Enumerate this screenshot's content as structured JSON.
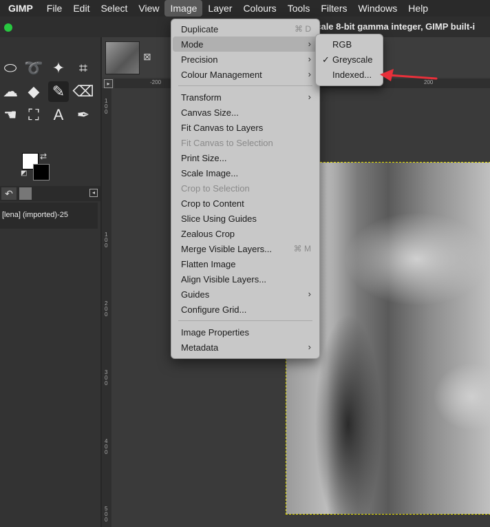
{
  "menubar": {
    "app": "GIMP",
    "items": [
      "File",
      "Edit",
      "Select",
      "View",
      "Image",
      "Layer",
      "Colours",
      "Tools",
      "Filters",
      "Windows",
      "Help"
    ],
    "active": "Image"
  },
  "window": {
    "title": "scale 8-bit gamma integer, GIMP built-i"
  },
  "layers_panel": {
    "layer_name": "[lena] (imported)-25"
  },
  "ruler": {
    "h_ticks": [
      "-200",
      "200"
    ],
    "v_ticks": [
      "1",
      "0",
      "0",
      "1",
      "0",
      "0",
      "2",
      "0",
      "0",
      "3",
      "0",
      "0",
      "4",
      "0",
      "0",
      "5",
      "0",
      "0"
    ]
  },
  "image_menu": {
    "items": [
      {
        "label": "Duplicate",
        "shortcut": "⌘ D"
      },
      {
        "label": "Mode",
        "submenu": true
      },
      {
        "label": "Precision",
        "submenu": true
      },
      {
        "label": "Colour Management",
        "submenu": true
      },
      {
        "label": "Transform",
        "submenu": true
      },
      {
        "label": "Canvas Size..."
      },
      {
        "label": "Fit Canvas to Layers"
      },
      {
        "label": "Fit Canvas to Selection",
        "disabled": true
      },
      {
        "label": "Print Size..."
      },
      {
        "label": "Scale Image..."
      },
      {
        "label": "Crop to Selection",
        "disabled": true
      },
      {
        "label": "Crop to Content"
      },
      {
        "label": "Slice Using Guides"
      },
      {
        "label": "Zealous Crop"
      },
      {
        "label": "Merge Visible Layers...",
        "shortcut": "⌘ M"
      },
      {
        "label": "Flatten Image"
      },
      {
        "label": "Align Visible Layers..."
      },
      {
        "label": "Guides",
        "submenu": true
      },
      {
        "label": "Configure Grid..."
      },
      {
        "label": "Image Properties"
      },
      {
        "label": "Metadata",
        "submenu": true
      }
    ]
  },
  "mode_submenu": {
    "items": [
      "RGB",
      "Greyscale",
      "Indexed..."
    ],
    "checked": "Greyscale"
  },
  "colors": {
    "annotation_arrow": "#e8303a",
    "selection_outline": "#e8e000"
  }
}
